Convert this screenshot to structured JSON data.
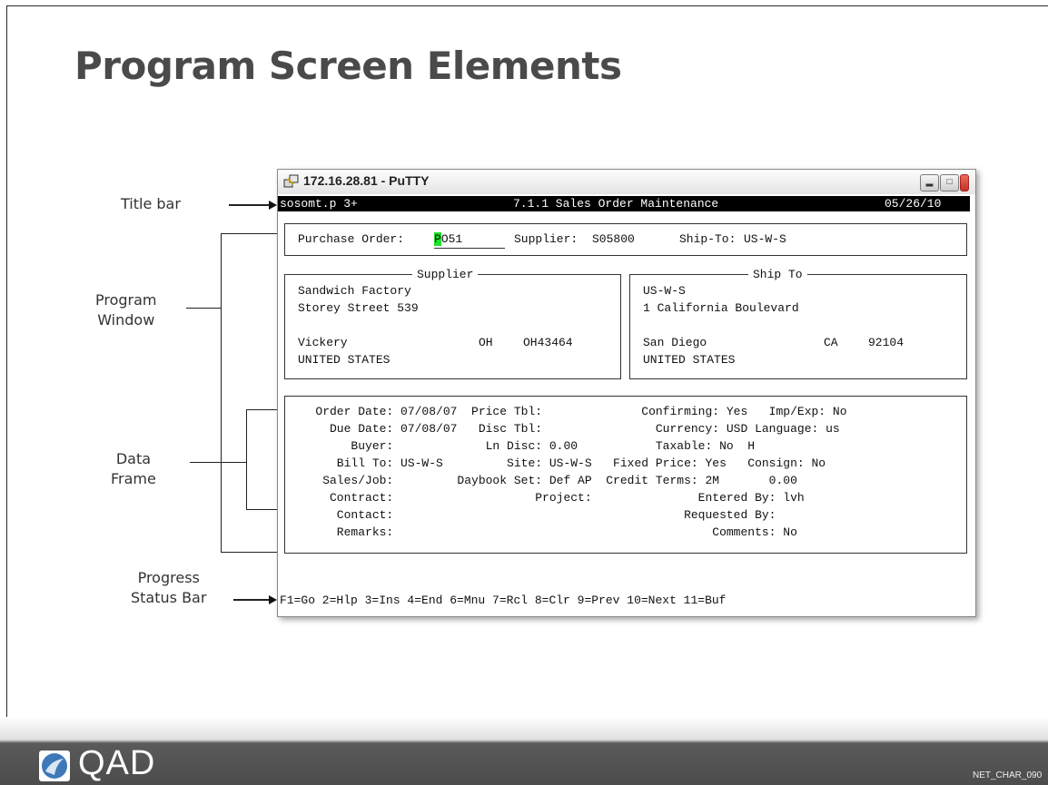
{
  "slide": {
    "title": "Program Screen Elements",
    "footer_logo_text": "QAD",
    "footer_code": "NET_CHAR_090"
  },
  "annotations": {
    "title_bar": "Title bar",
    "program_window": [
      "Program",
      "Window"
    ],
    "data_frame": [
      "Data",
      "Frame"
    ],
    "status_bar": [
      "Progress",
      "Status Bar"
    ]
  },
  "window": {
    "title": "172.16.28.81 - PuTTY",
    "icon": "putty-icon",
    "buttons": [
      "minimize",
      "maximize",
      "close"
    ]
  },
  "terminal": {
    "header": {
      "program": "sosomt.p 3+",
      "menu_title": "7.1.1 Sales Order Maintenance",
      "date": "05/26/10"
    },
    "top_frame": {
      "purchase_order_label": "Purchase Order:",
      "purchase_order_cursor": "P",
      "purchase_order_rest": "O51",
      "supplier_label": "Supplier:",
      "supplier_value": "S05800",
      "ship_to_label": "Ship-To:",
      "ship_to_value": "US-W-S"
    },
    "supplier_frame": {
      "legend": "Supplier",
      "line1": "Sandwich Factory",
      "line2": "Storey Street 539",
      "city": "Vickery",
      "state": "OH",
      "zip": "OH43464",
      "country": "UNITED STATES"
    },
    "shipto_frame": {
      "legend": "Ship To",
      "line1": "US-W-S",
      "line2": "1 California Boulevard",
      "city": "San Diego",
      "state": "CA",
      "zip": "92104",
      "country": "UNITED STATES"
    },
    "data_frame_rows": [
      "   Order Date: 07/08/07  Price Tbl:              Confirming: Yes   Imp/Exp: No",
      "     Due Date: 07/08/07   Disc Tbl:                Currency: USD Language: us",
      "        Buyer:             Ln Disc: 0.00           Taxable: No  H",
      "      Bill To: US-W-S         Site: US-W-S   Fixed Price: Yes   Consign: No",
      "    Sales/Job:         Daybook Set: Def AP  Credit Terms: 2M       0.00",
      "     Contract:                    Project:               Entered By: lvh",
      "      Contact:                                         Requested By:",
      "      Remarks:                                             Comments: No"
    ],
    "status_bar": "F1=Go 2=Hlp 3=Ins 4=End 6=Mnu 7=Rcl 8=Clr 9=Prev 10=Next 11=Buf"
  }
}
